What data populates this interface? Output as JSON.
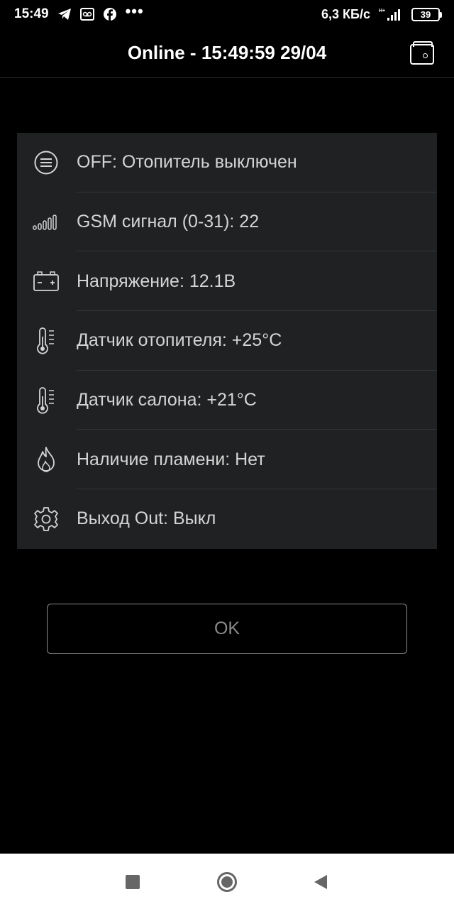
{
  "status_bar": {
    "time": "15:49",
    "icons": [
      "telegram-icon",
      "voicemail-icon",
      "facebook-icon"
    ],
    "more": "•••",
    "network_speed": "6,3 КБ/с",
    "battery_level": "39"
  },
  "header": {
    "title": "Online - 15:49:59 29/04",
    "wallet_icon": "wallet-icon"
  },
  "info_rows": [
    {
      "icon": "menu-circle-icon",
      "text": "OFF: Отопитель выключен"
    },
    {
      "icon": "signal-bars-icon",
      "text": "GSM сигнал (0-31): 22"
    },
    {
      "icon": "battery-voltage-icon",
      "text": "Напряжение: 12.1В"
    },
    {
      "icon": "thermometer-icon",
      "text": "Датчик отопителя: +25°C"
    },
    {
      "icon": "thermometer-icon",
      "text": "Датчик салона: +21°C"
    },
    {
      "icon": "flame-icon",
      "text": "Наличие пламени: Нет"
    },
    {
      "icon": "gear-icon",
      "text": "Выход Out: Выкл"
    }
  ],
  "ok_button": {
    "label": "OK"
  },
  "nav_bar": {
    "recents_icon": "square-recents-icon",
    "home_icon": "circle-home-icon",
    "back_icon": "triangle-back-icon"
  },
  "colors": {
    "background": "#000000",
    "card": "#1f2123",
    "row_text": "#d4d4d4",
    "divider": "#34373a",
    "button_text": "#8a8a8a"
  }
}
